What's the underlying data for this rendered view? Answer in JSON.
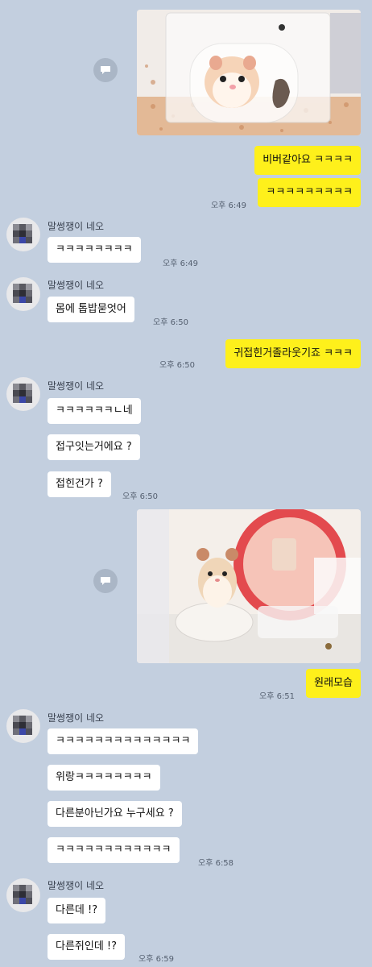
{
  "chat": {
    "sender": "말썽쟁이 네오",
    "messages": {
      "m1": "비버같아요 ㅋㅋㅋㅋ",
      "m2": "ㅋㅋㅋㅋㅋㅋㅋㅋㅋ",
      "t1": "오후 6:49",
      "r1": "ㅋㅋㅋㅋㅋㅋㅋㅋ",
      "t2": "오후 6:49",
      "r2": "몸에 톱밥묻엇어",
      "t3": "오후 6:50",
      "m3": "귀접힌거졸라웃기죠 ㅋㅋㅋ",
      "t4": "오후 6:50",
      "r3": "ㅋㅋㅋㅋㅋㅋㄴ네",
      "r4": "접구잇는거에요 ?",
      "r5": "접힌건가 ?",
      "t5": "오후 6:50",
      "m4": "원래모습",
      "t6": "오후 6:51",
      "r6": "ㅋㅋㅋㅋㅋㅋㅋㅋㅋㅋㅋㅋㅋㅋ",
      "r7": "위랑ㅋㅋㅋㅋㅋㅋㅋㅋ",
      "r8": "다른분아닌가요 누구세요 ?",
      "r9": "ㅋㅋㅋㅋㅋㅋㅋㅋㅋㅋㅋㅋ",
      "t7": "오후 6:58",
      "r10": "다른데 !?",
      "r11": "다른쥐인데 !?",
      "t8": "오후 6:59"
    }
  },
  "icons": {
    "share": "share-icon",
    "avatar": "pixelated-avatar"
  },
  "colors": {
    "background": "#c3cfdf",
    "my_bubble": "#fef01b",
    "their_bubble": "#ffffff"
  }
}
